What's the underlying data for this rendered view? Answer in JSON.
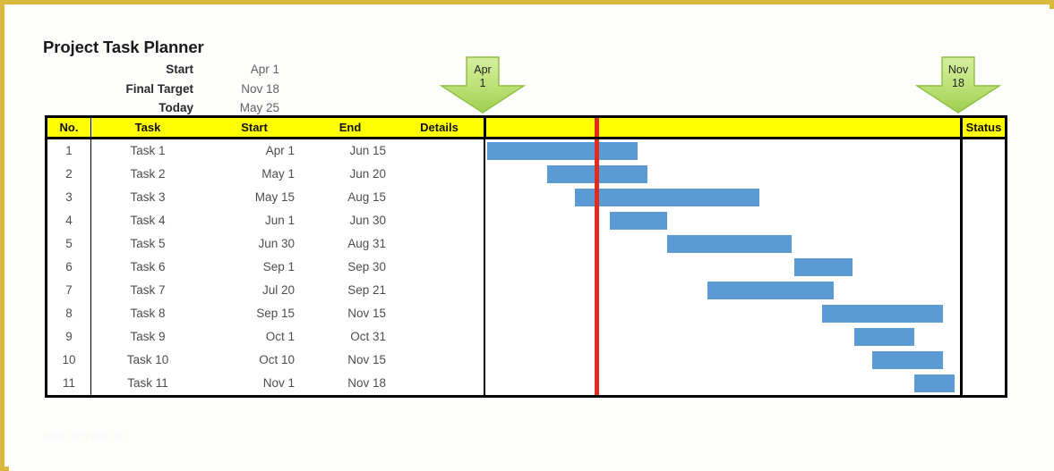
{
  "page": {
    "title": "Project Task Planner",
    "border_color": "#d9b93c",
    "watermark": "www.template.net"
  },
  "summary": [
    {
      "label": "Start",
      "value": "Apr 1"
    },
    {
      "label": "Final Target",
      "value": "Nov 18"
    },
    {
      "label": "Today",
      "value": "May 25"
    }
  ],
  "markers": [
    {
      "name": "start-marker",
      "line1": "Apr",
      "line2": "1",
      "color": "#b5dd6a"
    },
    {
      "name": "target-marker",
      "line1": "Nov",
      "line2": "18",
      "color": "#b5dd6a"
    }
  ],
  "table": {
    "headers": [
      "No.",
      "Task",
      "Start",
      "End",
      "Details",
      "Status"
    ],
    "header_bg": "#ffff00",
    "rows": [
      {
        "no": "1",
        "task": "Task 1",
        "start": "Apr 1",
        "end": "Jun 15",
        "details": "",
        "status": ""
      },
      {
        "no": "2",
        "task": "Task 2",
        "start": "May 1",
        "end": "Jun 20",
        "details": "",
        "status": ""
      },
      {
        "no": "3",
        "task": "Task 3",
        "start": "May 15",
        "end": "Aug 15",
        "details": "",
        "status": ""
      },
      {
        "no": "4",
        "task": "Task 4",
        "start": "Jun 1",
        "end": "Jun 30",
        "details": "",
        "status": ""
      },
      {
        "no": "5",
        "task": "Task 5",
        "start": "Jun 30",
        "end": "Aug 31",
        "details": "",
        "status": ""
      },
      {
        "no": "6",
        "task": "Task 6",
        "start": "Sep 1",
        "end": "Sep 30",
        "details": "",
        "status": ""
      },
      {
        "no": "7",
        "task": "Task 7",
        "start": "Jul 20",
        "end": "Sep 21",
        "details": "",
        "status": ""
      },
      {
        "no": "8",
        "task": "Task 8",
        "start": "Sep 15",
        "end": "Nov 15",
        "details": "",
        "status": ""
      },
      {
        "no": "9",
        "task": "Task 9",
        "start": "Oct 1",
        "end": "Oct 31",
        "details": "",
        "status": ""
      },
      {
        "no": "10",
        "task": "Task 10",
        "start": "Oct 10",
        "end": "Nov 15",
        "details": "",
        "status": ""
      },
      {
        "no": "11",
        "task": "Task 11",
        "start": "Nov 1",
        "end": "Nov 18",
        "details": "",
        "status": ""
      }
    ]
  },
  "chart_data": {
    "type": "bar",
    "title": "Project Task Planner",
    "orientation": "horizontal",
    "subtype": "gantt",
    "xlabel": "",
    "ylabel": "",
    "bar_color": "#5b9bd5",
    "today_line_color": "#e02b20",
    "axis_start": "Apr 1",
    "axis_end": "Nov 18",
    "today": "May 25",
    "today_fraction": 0.2304,
    "categories": [
      "Task 1",
      "Task 2",
      "Task 3",
      "Task 4",
      "Task 5",
      "Task 6",
      "Task 7",
      "Task 8",
      "Task 9",
      "Task 10",
      "Task 11"
    ],
    "tasks": [
      {
        "name": "Task 1",
        "start": "Apr 1",
        "end": "Jun 15",
        "start_frac": 0.0,
        "end_frac": 0.3211
      },
      {
        "name": "Task 2",
        "start": "May 1",
        "end": "Jun 20",
        "start_frac": 0.1281,
        "end_frac": 0.3425
      },
      {
        "name": "Task 3",
        "start": "May 15",
        "end": "Aug 15",
        "start_frac": 0.1884,
        "end_frac": 0.583
      },
      {
        "name": "Task 4",
        "start": "Jun 1",
        "end": "Jun 30",
        "start_frac": 0.2615,
        "end_frac": 0.3854
      },
      {
        "name": "Task 5",
        "start": "Jun 30",
        "end": "Aug 31",
        "start_frac": 0.3854,
        "end_frac": 0.6518
      },
      {
        "name": "Task 6",
        "start": "Sep 1",
        "end": "Sep 30",
        "start_frac": 0.6567,
        "end_frac": 0.7807
      },
      {
        "name": "Task 7",
        "start": "Jul 20",
        "end": "Sep 21",
        "start_frac": 0.4721,
        "end_frac": 0.7421
      },
      {
        "name": "Task 8",
        "start": "Sep 15",
        "end": "Nov 15",
        "start_frac": 0.7163,
        "end_frac": 0.9742
      },
      {
        "name": "Task 9",
        "start": "Oct 1",
        "end": "Oct 31",
        "start_frac": 0.785,
        "end_frac": 0.9141
      },
      {
        "name": "Task 10",
        "start": "Oct 10",
        "end": "Nov 15",
        "start_frac": 0.824,
        "end_frac": 0.9742
      },
      {
        "name": "Task 11",
        "start": "Nov 1",
        "end": "Nov 18",
        "start_frac": 0.9141,
        "end_frac": 1.0
      }
    ]
  }
}
